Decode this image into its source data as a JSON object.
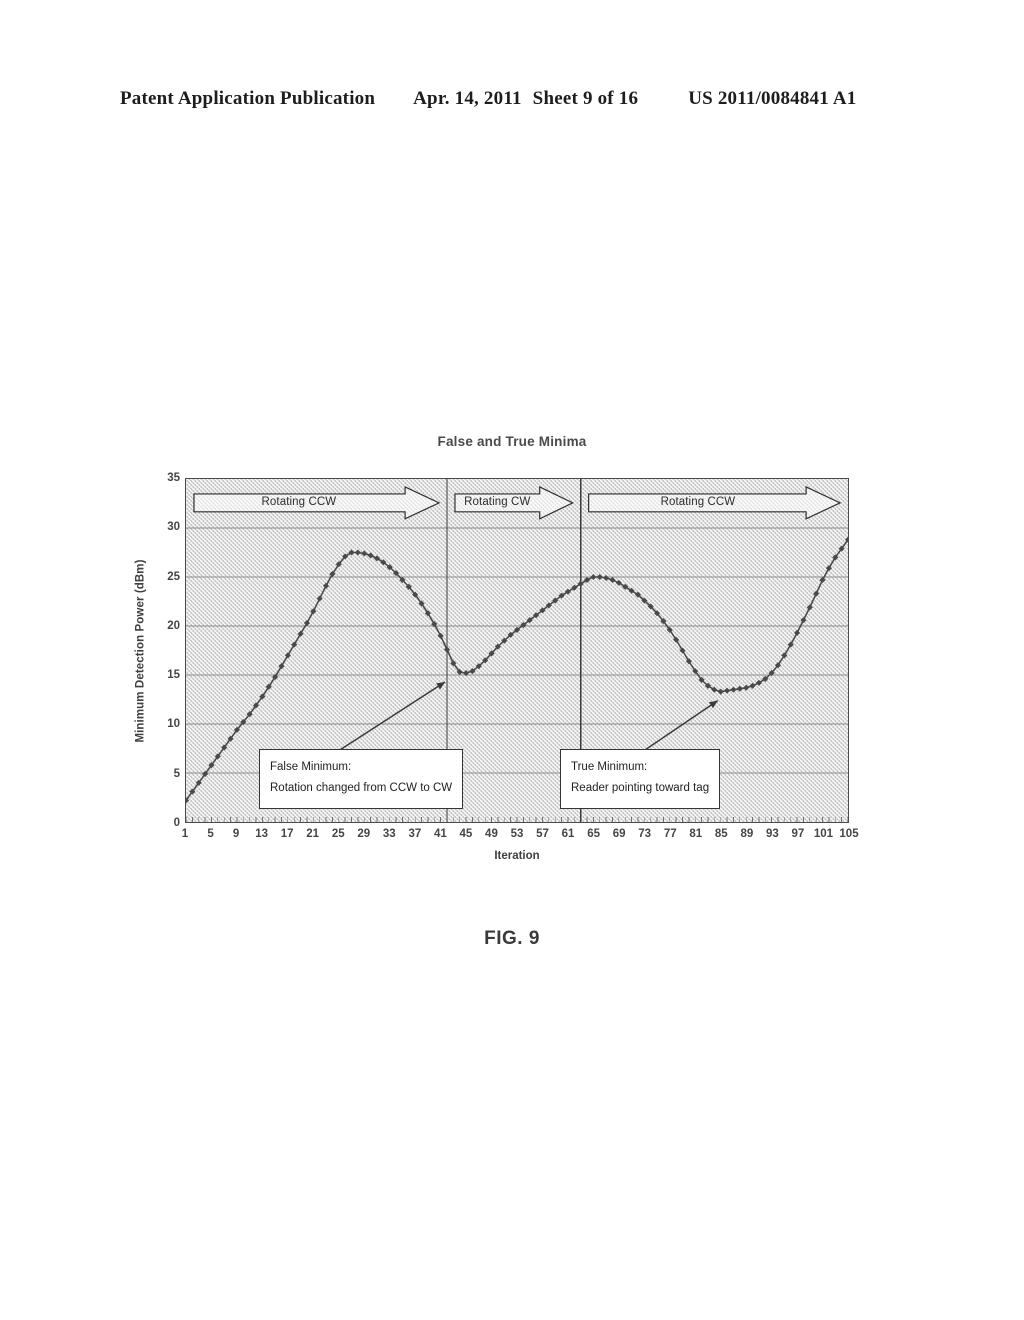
{
  "header": {
    "publication": "Patent Application Publication",
    "date": "Apr. 14, 2011",
    "sheet": "Sheet 9 of 16",
    "patent_number": "US 2011/0084841 A1"
  },
  "figure": {
    "caption": "FIG. 9"
  },
  "chart_data": {
    "type": "line",
    "title": "False and True Minima",
    "xlabel": "Iteration",
    "ylabel": "Minimum Detection Power (dBm)",
    "xlim": [
      1,
      105
    ],
    "ylim": [
      0,
      35
    ],
    "ytick_step": 5,
    "xtick_step": 4,
    "grid": true,
    "marker": "diamond",
    "line_color": "#4a4a4a",
    "plot_background": "#d9d9d9",
    "yticks": [
      0,
      5,
      10,
      15,
      20,
      25,
      30,
      35
    ],
    "xticks": [
      1,
      5,
      9,
      13,
      17,
      21,
      25,
      29,
      33,
      37,
      41,
      45,
      49,
      53,
      57,
      61,
      65,
      69,
      73,
      77,
      81,
      85,
      89,
      93,
      97,
      101,
      105
    ],
    "series": [
      {
        "name": "Minimum Detection Power",
        "x": [
          1,
          2,
          3,
          4,
          5,
          6,
          7,
          8,
          9,
          10,
          11,
          12,
          13,
          14,
          15,
          16,
          17,
          18,
          19,
          20,
          21,
          22,
          23,
          24,
          25,
          26,
          27,
          28,
          29,
          30,
          31,
          32,
          33,
          34,
          35,
          36,
          37,
          38,
          39,
          40,
          41,
          42,
          43,
          44,
          45,
          46,
          47,
          48,
          49,
          50,
          51,
          52,
          53,
          54,
          55,
          56,
          57,
          58,
          59,
          60,
          61,
          62,
          63,
          64,
          65,
          66,
          67,
          68,
          69,
          70,
          71,
          72,
          73,
          74,
          75,
          76,
          77,
          78,
          79,
          80,
          81,
          82,
          83,
          84,
          85,
          86,
          87,
          88,
          89,
          90,
          91,
          92,
          93,
          94,
          95,
          96,
          97,
          98,
          99,
          100,
          101,
          102,
          103,
          104,
          105
        ],
        "y": [
          2.2,
          3.1,
          4.0,
          4.9,
          5.8,
          6.7,
          7.6,
          8.5,
          9.4,
          10.2,
          11.0,
          11.9,
          12.8,
          13.8,
          14.8,
          15.9,
          17.0,
          18.1,
          19.2,
          20.3,
          21.5,
          22.8,
          24.1,
          25.3,
          26.3,
          27.1,
          27.5,
          27.5,
          27.4,
          27.2,
          26.9,
          26.5,
          26.0,
          25.4,
          24.7,
          24.0,
          23.2,
          22.3,
          21.3,
          20.2,
          19.0,
          17.6,
          16.2,
          15.3,
          15.2,
          15.4,
          15.9,
          16.5,
          17.2,
          17.9,
          18.5,
          19.1,
          19.6,
          20.1,
          20.6,
          21.1,
          21.6,
          22.1,
          22.6,
          23.1,
          23.5,
          23.9,
          24.3,
          24.7,
          25.0,
          25.0,
          24.9,
          24.7,
          24.4,
          24.0,
          23.6,
          23.2,
          22.6,
          22.0,
          21.3,
          20.5,
          19.6,
          18.6,
          17.5,
          16.4,
          15.4,
          14.5,
          13.9,
          13.5,
          13.3,
          13.4,
          13.5,
          13.6,
          13.7,
          13.9,
          14.2,
          14.6,
          15.2,
          16.0,
          17.0,
          18.1,
          19.3,
          20.6,
          21.9,
          23.3,
          24.7,
          25.9,
          27.0,
          27.9,
          28.8
        ]
      }
    ],
    "regions": [
      {
        "label": "Rotating CCW",
        "x_start": 1,
        "x_end": 42,
        "arrow": "right"
      },
      {
        "label": "Rotating CW",
        "x_start": 42,
        "x_end": 63,
        "arrow": "right"
      },
      {
        "label": "Rotating CCW",
        "x_start": 63,
        "x_end": 105,
        "arrow": "right"
      }
    ],
    "dividers": [
      42,
      63
    ],
    "annotations": [
      {
        "id": "false-minimum",
        "lines": [
          "False Minimum:",
          "Rotation changed from CCW to CW"
        ],
        "target_x": 42,
        "target_y": 15.2
      },
      {
        "id": "true-minimum",
        "lines": [
          "True Minimum:",
          "Reader pointing toward tag"
        ],
        "target_x": 85,
        "target_y": 13.3
      }
    ]
  }
}
